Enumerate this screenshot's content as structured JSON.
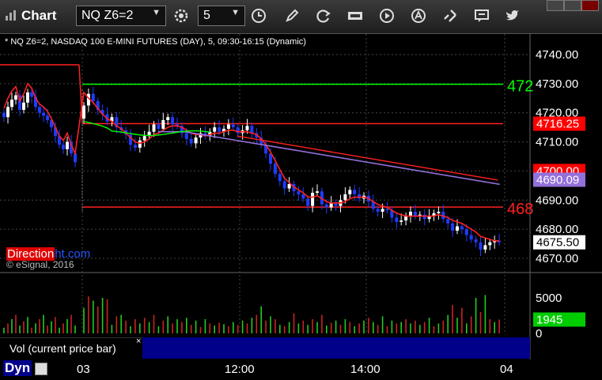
{
  "toolbar": {
    "app_title": "Chart",
    "symbol": "NQ Z6=2",
    "interval": "5"
  },
  "chart_header": "* NQ Z6=2, NASDAQ 100 E-MINI FUTURES (DAY), 5, 09:30-16:15 (Dynamic)",
  "watermark": {
    "brand_part1": "Direction",
    "brand_part2": "ht.com",
    "copyright": "© eSignal, 2016"
  },
  "volume_panel": {
    "label": "Vol (current price bar)",
    "close_symbol": "×",
    "current_volume": "1945"
  },
  "bottom": {
    "dyn_label": "Dyn",
    "time_labels": [
      "03",
      "12:00",
      "14:00",
      "04"
    ]
  },
  "colors": {
    "background": "#000000",
    "up_candle": "#ffffff",
    "down_candle": "#1f3cff",
    "red_level": "#ff2020",
    "green_level": "#00ff00",
    "vwap": "#9370db",
    "volume_up": "#22cc22",
    "volume_down": "#cc2222"
  },
  "chart_data": {
    "type": "candlestick",
    "title": "NQ Z6=2, NASDAQ 100 E-MINI FUTURES (DAY), 5, 09:30-16:15 (Dynamic)",
    "ylim": [
      4667,
      4743
    ],
    "y_ticks": [
      "4740.00",
      "4730.00",
      "4720.00",
      "4710.00",
      "4700.00",
      "4690.00",
      "4680.00",
      "4670.00"
    ],
    "volume_ylim": [
      0,
      8000
    ],
    "volume_ticks": [
      "5000",
      "0"
    ],
    "price_tags": [
      {
        "label": "4716.25",
        "value": 4716.25,
        "color": "#ff0000"
      },
      {
        "label": "4700.00",
        "value": 4700.0,
        "color": "#ff0000"
      },
      {
        "label": "4690.09",
        "value": 4697.0,
        "color": "#9370db"
      },
      {
        "label": "4675.50",
        "value": 4675.5,
        "color": "#ffffff"
      },
      {
        "label": "1945",
        "value": 1945,
        "color": "#00cc00",
        "panel": "volume"
      }
    ],
    "level_labels": [
      {
        "label": "472",
        "value": 4729.8,
        "color": "#00ff00"
      },
      {
        "label": "468",
        "value": 4687.6,
        "color": "#ff2020"
      }
    ],
    "prior_day_closes": [
      4718.5,
      4722.0,
      4724.5,
      4726.0,
      4721.0,
      4723.5,
      4727.0,
      4725.5,
      4722.0,
      4720.0,
      4719.0,
      4717.5,
      4715.0,
      4712.0,
      4709.0,
      4707.5,
      4710.0,
      4706.0,
      4703.0
    ],
    "session_closes": [
      4722.5,
      4726.5,
      4724.0,
      4721.0,
      4719.5,
      4717.0,
      4718.5,
      4715.0,
      4714.0,
      4712.5,
      4709.0,
      4708.0,
      4710.5,
      4712.0,
      4713.5,
      4716.0,
      4714.5,
      4717.5,
      4718.5,
      4716.0,
      4715.5,
      4713.0,
      4711.0,
      4709.5,
      4711.5,
      4713.0,
      4712.0,
      4713.5,
      4715.0,
      4713.5,
      4714.5,
      4716.0,
      4715.0,
      4713.0,
      4714.0,
      4715.5,
      4713.0,
      4711.5,
      4709.0,
      4706.0,
      4702.5,
      4699.0,
      4696.5,
      4694.0,
      4695.5,
      4693.0,
      4692.0,
      4690.5,
      4688.0,
      4692.5,
      4693.0,
      4688.5,
      4687.5,
      4689.0,
      4688.0,
      4690.0,
      4692.0,
      4693.5,
      4692.0,
      4690.5,
      4691.5,
      4689.5,
      4687.0,
      4686.0,
      4687.0,
      4686.5,
      4684.0,
      4682.5,
      4683.0,
      4684.5,
      4686.0,
      4684.5,
      4685.0,
      4683.5,
      4684.5,
      4685.5,
      4686.0,
      4683.5,
      4682.0,
      4679.5,
      4681.0,
      4680.0,
      4678.0,
      4676.5,
      4675.5,
      4673.0,
      4674.5,
      4675.5,
      4676.0,
      4675.5
    ],
    "session_volume": [
      3600,
      5200,
      4600,
      3800,
      5000,
      4800,
      1200,
      2400,
      2600,
      1800,
      1000,
      2000,
      1400,
      2200,
      1600,
      2600,
      1000,
      1800,
      2400,
      1400,
      2000,
      1600,
      2200,
      1200,
      1800,
      900,
      2000,
      1400,
      1100,
      1500,
      1300,
      1000,
      1600,
      1200,
      1800,
      1400,
      2200,
      2600,
      3800,
      1800,
      2400,
      2000,
      1200,
      1000,
      1600,
      2800,
      1400,
      1800,
      1200,
      2000,
      1600,
      2600,
      1100,
      1500,
      1800,
      1200,
      2000,
      1600,
      1000,
      1400,
      1800,
      2200,
      1600,
      1200,
      2400,
      1000,
      1800,
      1400,
      1600,
      2000,
      1400,
      1800,
      1200,
      1600,
      2200,
      1000,
      1400,
      1800,
      2600,
      4000,
      2200,
      3600,
      1400,
      2400,
      5000,
      3000,
      5400,
      2000,
      1600,
      1945
    ],
    "open_range": {
      "low_x": 0,
      "high_x": 6,
      "label": "03"
    },
    "ema_red": [
      4727.0,
      4725.0,
      4723.5,
      4721.5,
      4719.5,
      4718.0,
      4717.0,
      4715.5,
      4714.5,
      4713.0,
      4711.5,
      4710.0,
      4709.5,
      4710.0,
      4711.0,
      4712.5,
      4713.0,
      4714.0,
      4715.0,
      4715.5,
      4715.5,
      4715.0,
      4714.0,
      4713.0,
      4712.5,
      4712.5,
      4712.0,
      4712.5,
      4713.0,
      4713.0,
      4713.5,
      4714.0,
      4714.0,
      4713.5,
      4713.5,
      4713.5,
      4713.0,
      4712.5,
      4711.0,
      4709.0,
      4706.5,
      4703.5,
      4700.5,
      4697.5,
      4696.0,
      4694.5,
      4693.5,
      4692.5,
      4691.0,
      4691.0,
      4691.5,
      4690.5,
      4689.5,
      4689.0,
      4689.0,
      4689.0,
      4689.5,
      4690.5,
      4691.0,
      4691.0,
      4691.0,
      4690.5,
      4689.5,
      4688.5,
      4688.0,
      4687.5,
      4686.5,
      4685.5,
      4685.0,
      4684.5,
      4684.5,
      4684.5,
      4684.5,
      4684.5,
      4684.5,
      4684.5,
      4685.0,
      4684.5,
      4684.0,
      4683.0,
      4682.5,
      4682.0,
      4681.0,
      4680.0,
      4679.0,
      4677.5,
      4677.0,
      4676.5,
      4676.0,
      4676.0
    ]
  }
}
